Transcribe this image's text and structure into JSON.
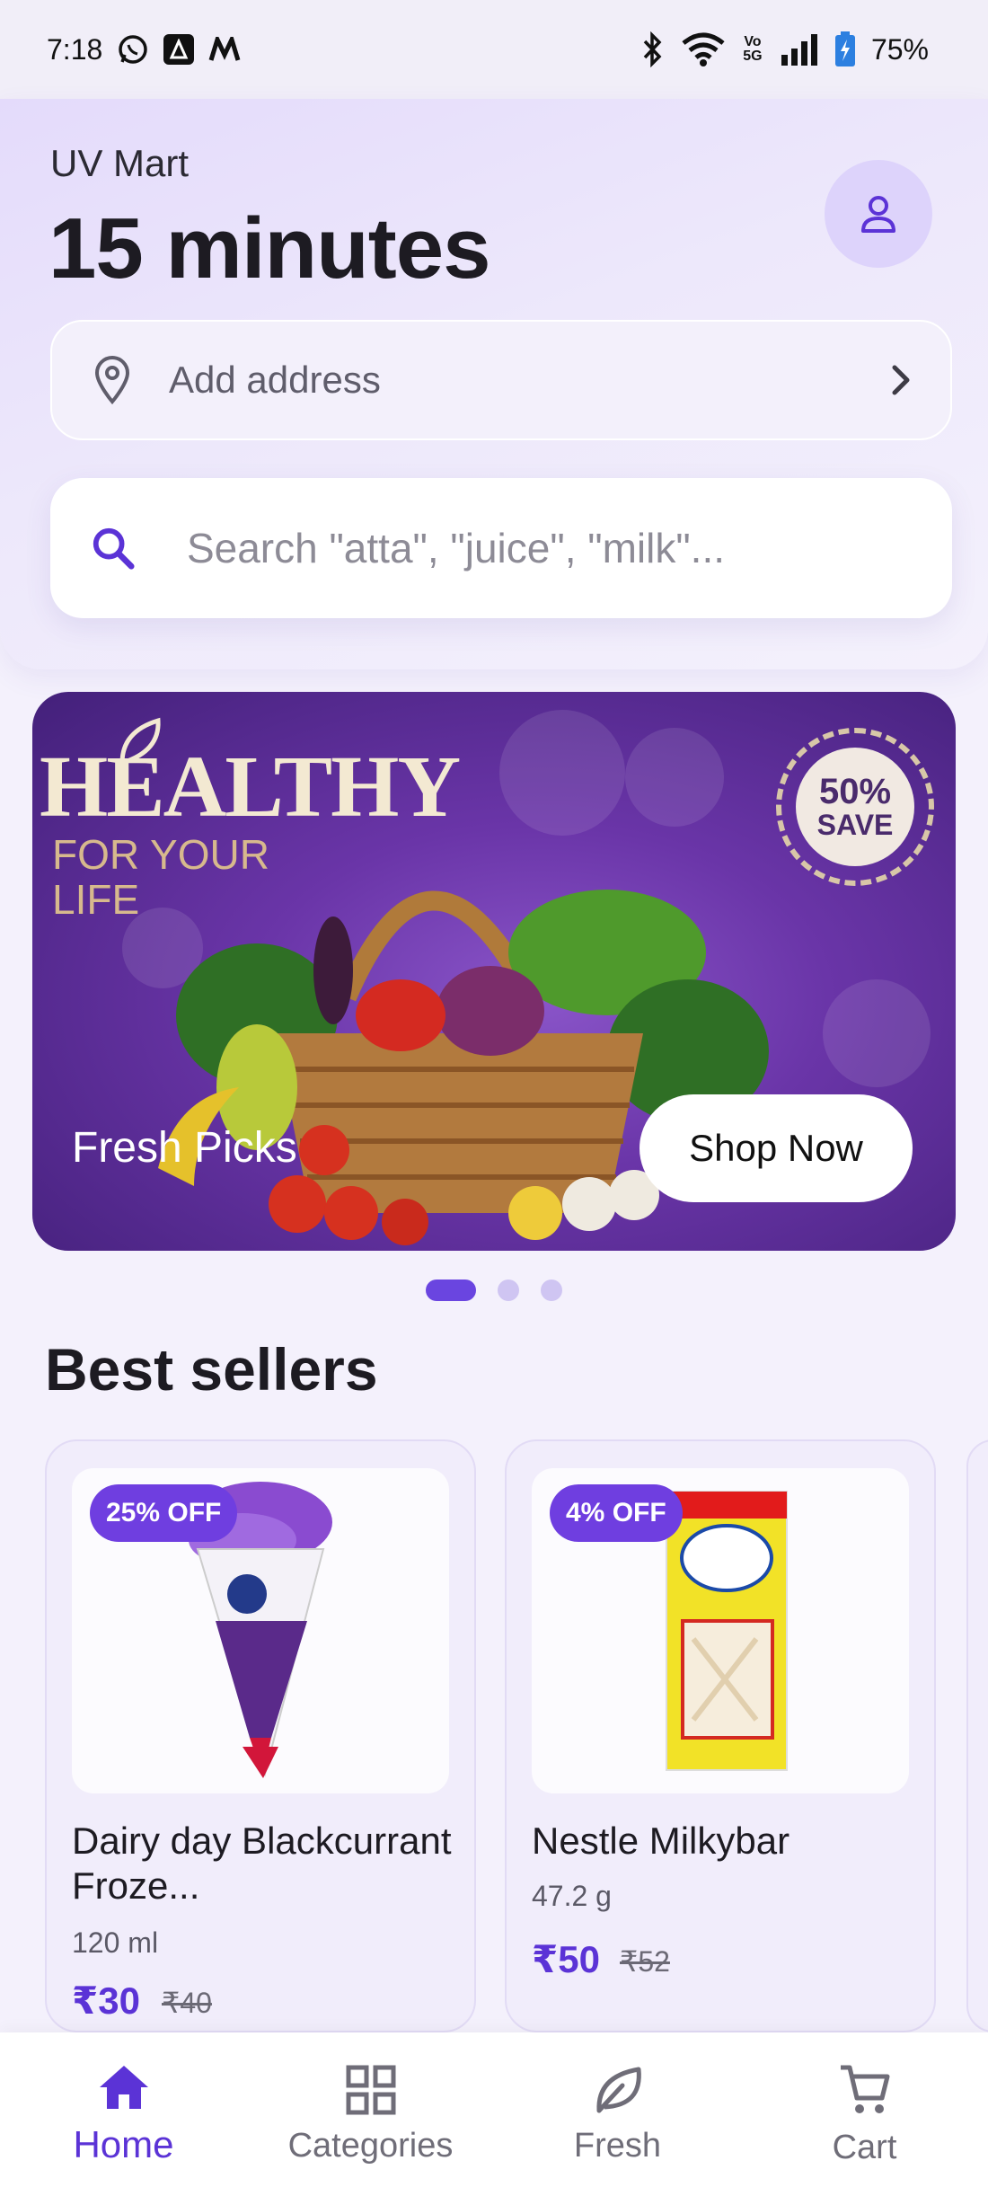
{
  "status_bar": {
    "time": "7:18",
    "battery": "75%",
    "icons": [
      "whatsapp-icon",
      "app-a-icon",
      "app-m-icon",
      "bluetooth-icon",
      "wifi-icon",
      "volte-icon",
      "signal-icon",
      "battery-icon"
    ],
    "volte": "Vo 5G"
  },
  "header": {
    "store_name": "UV Mart",
    "eta": "15 minutes",
    "address_label": "Add address",
    "search_placeholder": "Search \"atta\", \"juice\", \"milk\"..."
  },
  "banner": {
    "headline": "HEALTHY",
    "subline": "FOR YOUR LIFE",
    "seal_pct": "50%",
    "seal_save": "SAVE",
    "caption": "Fresh Picks",
    "cta": "Shop Now",
    "slide_count": 3,
    "active_slide": 1
  },
  "best_sellers": {
    "title": "Best sellers",
    "products": [
      {
        "badge": "25% OFF",
        "name": "Dairy day Blackcurrant Froze...",
        "qty": "120 ml",
        "price": "₹30",
        "mrp": "₹40"
      },
      {
        "badge": "4% OFF",
        "name": "Nestle Milkybar",
        "qty": "47.2 g",
        "price": "₹50",
        "mrp": "₹52"
      }
    ]
  },
  "bottom_nav": {
    "items": [
      {
        "label": "Home",
        "icon": "home-icon",
        "active": true
      },
      {
        "label": "Categories",
        "icon": "grid-icon",
        "active": false
      },
      {
        "label": "Fresh",
        "icon": "leaf-icon",
        "active": false
      },
      {
        "label": "Cart",
        "icon": "cart-icon",
        "active": false
      }
    ]
  },
  "colors": {
    "accent": "#5b33d6",
    "badge": "#6f3ee0",
    "banner": "#6a35a8"
  }
}
